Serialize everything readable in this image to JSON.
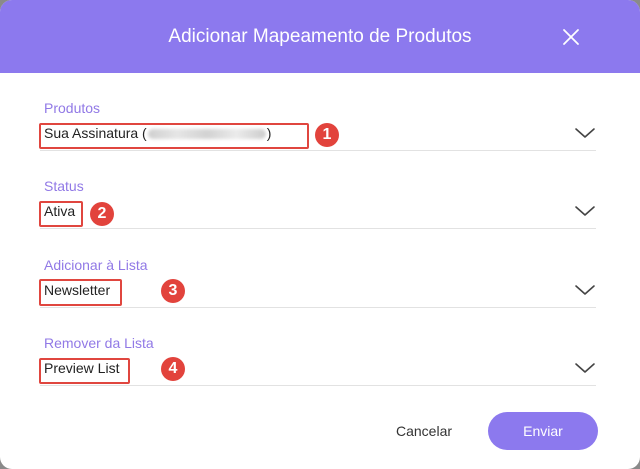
{
  "modal": {
    "title": "Adicionar Mapeamento de Produtos",
    "close_icon": "close-icon"
  },
  "fields": {
    "produtos": {
      "label": "Produtos",
      "value_prefix": "Sua Assinatura (",
      "value_suffix": ")",
      "marker": "1"
    },
    "status": {
      "label": "Status",
      "value": "Ativa",
      "marker": "2"
    },
    "adicionar": {
      "label": "Adicionar à Lista",
      "value": "Newsletter",
      "marker": "3"
    },
    "remover": {
      "label": "Remover da Lista",
      "value": "Preview List",
      "marker": "4"
    }
  },
  "footer": {
    "cancel_label": "Cancelar",
    "submit_label": "Enviar"
  },
  "colors": {
    "accent": "#8c79ee",
    "label": "#9179e6",
    "highlight": "#e0463f"
  }
}
